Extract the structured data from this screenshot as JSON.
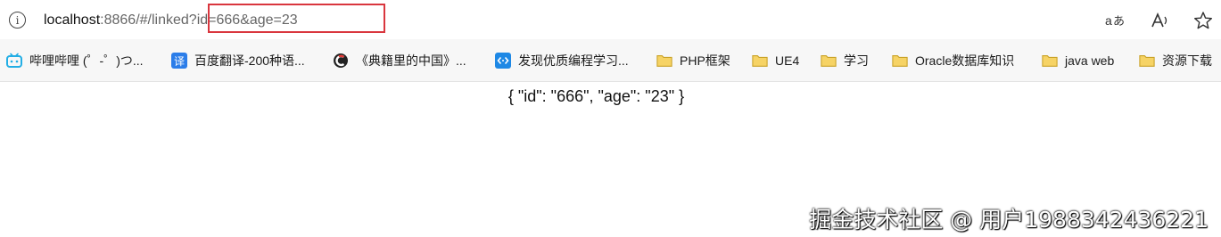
{
  "address_bar": {
    "host": "localhost",
    "path": ":8866/#/linked",
    "query": "?id=666&age=23"
  },
  "toolbar": {
    "read_aloud_icon": "read-aloud-icon",
    "translate_icon": "translate-icon",
    "favorite_icon": "star-icon"
  },
  "bookmarks": [
    {
      "label": "哔哩哔哩 (゜-゜)つ...",
      "icon": "bilibili-icon"
    },
    {
      "label": "百度翻译-200种语...",
      "icon": "baidu-translate-icon"
    },
    {
      "label": "《典籍里的中国》...",
      "icon": "cctv-icon"
    },
    {
      "label": "发现优质编程学习...",
      "icon": "code-icon"
    },
    {
      "label": "PHP框架",
      "icon": "folder-icon"
    },
    {
      "label": "UE4",
      "icon": "folder-icon"
    },
    {
      "label": "学习",
      "icon": "folder-icon"
    },
    {
      "label": "Oracle数据库知识",
      "icon": "folder-icon"
    },
    {
      "label": "java web",
      "icon": "folder-icon"
    },
    {
      "label": "资源下载",
      "icon": "folder-icon"
    }
  ],
  "content": {
    "json_text": "{ \"id\": \"666\", \"age\": \"23\" }"
  },
  "watermark": "掘金技术社区 @ 用户1988342436221",
  "colors": {
    "highlight": "#d9363e",
    "folder": "#f2c94c",
    "bilibili": "#23aee5",
    "baidu": "#2b7de9",
    "code": "#1e88e5"
  }
}
